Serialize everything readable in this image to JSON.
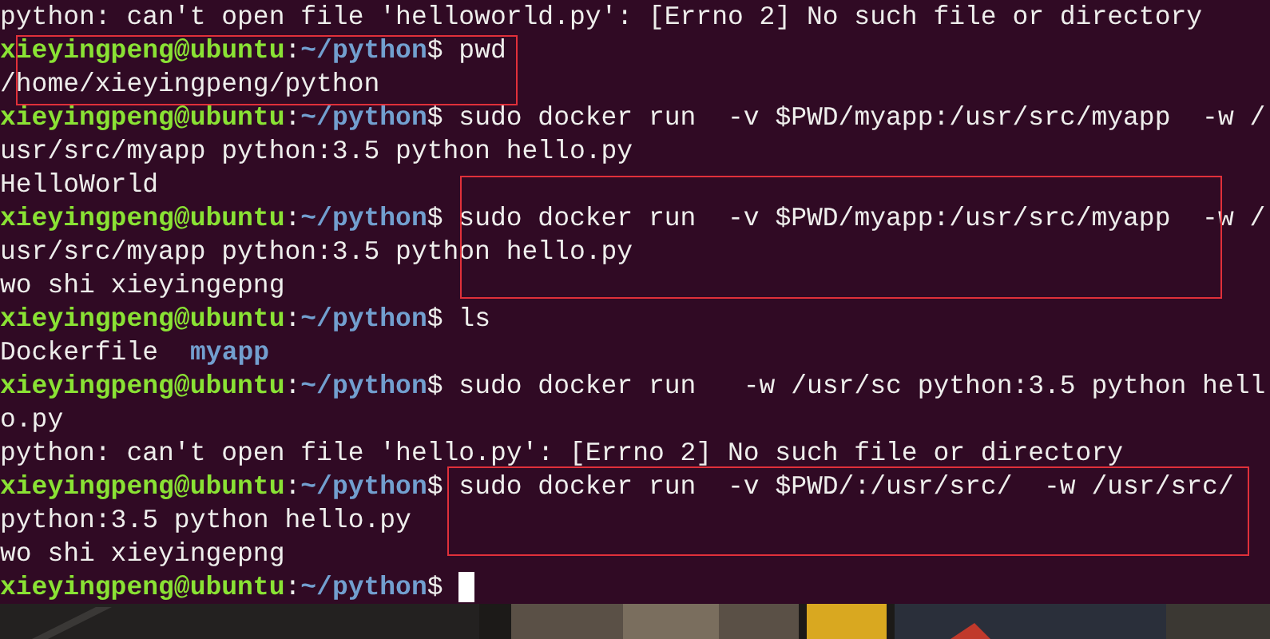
{
  "terminal": {
    "lines": [
      {
        "kind": "output",
        "text": "python: can't open file 'helloworld.py': [Errno 2] No such file or directory"
      },
      {
        "kind": "prompt",
        "user_host": "xieyingpeng@ubuntu",
        "separator": ":",
        "path": "~/python",
        "sign": "$",
        "command": "pwd"
      },
      {
        "kind": "output",
        "text": "/home/xieyingpeng/python"
      },
      {
        "kind": "prompt",
        "user_host": "xieyingpeng@ubuntu",
        "separator": ":",
        "path": "~/python",
        "sign": "$",
        "command": "sudo docker run  -v $PWD/myapp:/usr/src/myapp  -w /"
      },
      {
        "kind": "output",
        "text": "usr/src/myapp python:3.5 python hello.py"
      },
      {
        "kind": "output",
        "text": "HelloWorld"
      },
      {
        "kind": "prompt",
        "user_host": "xieyingpeng@ubuntu",
        "separator": ":",
        "path": "~/python",
        "sign": "$",
        "command": "sudo docker run  -v $PWD/myapp:/usr/src/myapp  -w /"
      },
      {
        "kind": "output",
        "text": "usr/src/myapp python:3.5 python hello.py"
      },
      {
        "kind": "output",
        "text": "wo shi xieyingepng"
      },
      {
        "kind": "prompt",
        "user_host": "xieyingpeng@ubuntu",
        "separator": ":",
        "path": "~/python",
        "sign": "$",
        "command": "ls"
      },
      {
        "kind": "listing",
        "entries": [
          {
            "name": "Dockerfile",
            "kind": "file"
          },
          {
            "name": "myapp",
            "kind": "dir"
          }
        ]
      },
      {
        "kind": "prompt",
        "user_host": "xieyingpeng@ubuntu",
        "separator": ":",
        "path": "~/python",
        "sign": "$",
        "command": "sudo docker run   -w /usr/sc python:3.5 python hell"
      },
      {
        "kind": "output",
        "text": "o.py"
      },
      {
        "kind": "output",
        "text": "python: can't open file 'hello.py': [Errno 2] No such file or directory"
      },
      {
        "kind": "prompt",
        "user_host": "xieyingpeng@ubuntu",
        "separator": ":",
        "path": "~/python",
        "sign": "$",
        "command": "sudo docker run  -v $PWD/:/usr/src/  -w /usr/src/"
      },
      {
        "kind": "output",
        "text": "python:3.5 python hello.py"
      },
      {
        "kind": "output",
        "text": "wo shi xieyingepng"
      },
      {
        "kind": "prompt",
        "user_host": "xieyingpeng@ubuntu",
        "separator": ":",
        "path": "~/python",
        "sign": "$",
        "cursor": true
      }
    ]
  }
}
